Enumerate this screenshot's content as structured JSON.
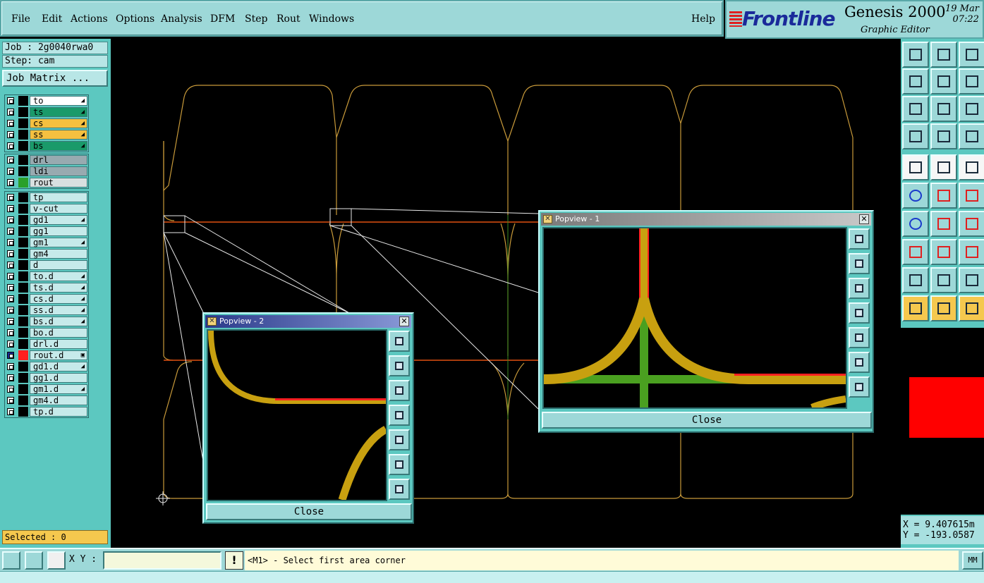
{
  "menu": {
    "items": [
      "File",
      "Edit",
      "Actions",
      "Options",
      "Analysis",
      "DFM",
      "Step",
      "Rout",
      "Windows"
    ],
    "help": "Help"
  },
  "brand": {
    "logo": "Frontline",
    "title": "Genesis 2000",
    "subtitle": "Graphic Editor",
    "date": "19 Mar",
    "time": "07:22"
  },
  "job": {
    "job_label": "Job : 2g0040rwa0",
    "step_label": "Step: cam",
    "matrix_button": "Job Matrix ..."
  },
  "layers": {
    "group1": [
      {
        "name": "to",
        "color": "#ffffff",
        "mark": "◢"
      },
      {
        "name": "ts",
        "color": "#1a9a6a",
        "mark": "◢"
      },
      {
        "name": "cs",
        "color": "#f5c040",
        "mark": "◢"
      },
      {
        "name": "ss",
        "color": "#f5c040",
        "mark": "◢"
      },
      {
        "name": "bs",
        "color": "#1a9a6a",
        "mark": "◢"
      }
    ],
    "group2": [
      {
        "name": "drl",
        "color": "#98aab0",
        "mark": ""
      },
      {
        "name": "ldi",
        "color": "#98aab0",
        "mark": ""
      },
      {
        "name": "rout",
        "color": "#d8e0e0",
        "mark": "",
        "swatch": "#2aa02a"
      }
    ],
    "group3": [
      {
        "name": "tp",
        "mark": ""
      },
      {
        "name": "v-cut",
        "mark": ""
      },
      {
        "name": "gd1",
        "mark": "◢"
      },
      {
        "name": "gg1",
        "mark": ""
      },
      {
        "name": "gm1",
        "mark": "◢"
      },
      {
        "name": "gm4",
        "mark": ""
      },
      {
        "name": "d",
        "mark": ""
      },
      {
        "name": "to.d",
        "mark": "◢"
      },
      {
        "name": "ts.d",
        "mark": "◢"
      },
      {
        "name": "cs.d",
        "mark": "◢"
      },
      {
        "name": "ss.d",
        "mark": "◢"
      },
      {
        "name": "bs.d",
        "mark": "◢"
      },
      {
        "name": "bo.d",
        "mark": ""
      },
      {
        "name": "drl.d",
        "mark": ""
      },
      {
        "name": "rout.d",
        "mark": "▣",
        "swatch": "#ff2020",
        "active": true
      },
      {
        "name": "gd1.d",
        "mark": "◢"
      },
      {
        "name": "gg1.d",
        "mark": ""
      },
      {
        "name": "gm1.d",
        "mark": "◢"
      },
      {
        "name": "gm4.d",
        "mark": ""
      },
      {
        "name": "tp.d",
        "mark": ""
      }
    ]
  },
  "selected": "Selected : 0",
  "popup1": {
    "title": "Popview - 1",
    "close": "Close"
  },
  "popup2": {
    "title": "Popview - 2",
    "close": "Close"
  },
  "coords": {
    "x": "X = 9.407615m",
    "y": "Y = -193.0587"
  },
  "bottom": {
    "xy_label": "X Y :",
    "xy_value": "",
    "warn": "!",
    "prompt": "<M1> - Select first area corner",
    "units": "MM"
  },
  "colors": {
    "outline": "#c89a3a",
    "rout": "#e05010",
    "trace": "#c8a010",
    "green": "#4aa020",
    "red": "#ff2020",
    "panel": "#5cc8c0",
    "menu": "#9dd8d8"
  }
}
